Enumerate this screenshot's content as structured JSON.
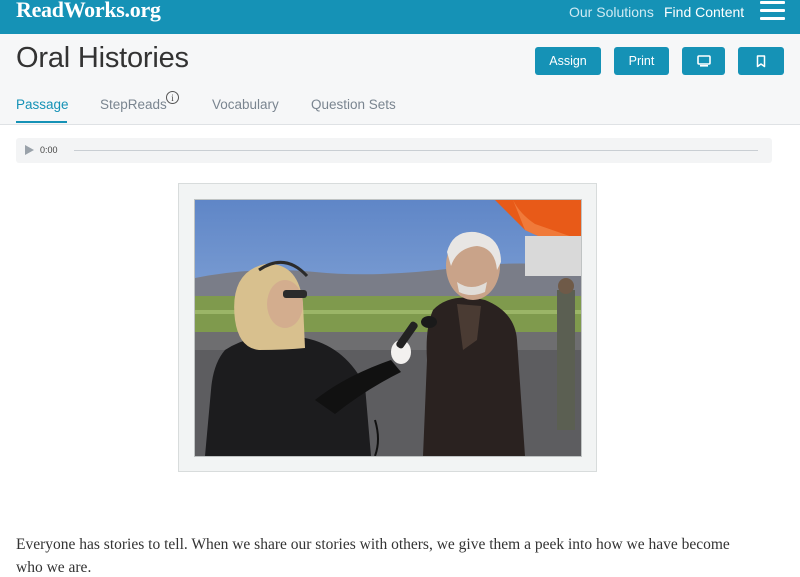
{
  "brand": {
    "name": "ReadWorks",
    "tld": ".org"
  },
  "nav": {
    "solutions": "Our Solutions",
    "find_content": "Find Content"
  },
  "page": {
    "title": "Oral Histories"
  },
  "actions": {
    "assign": "Assign",
    "print": "Print"
  },
  "tabs": [
    {
      "label": "Passage",
      "active": true
    },
    {
      "label": "StepReads"
    },
    {
      "label": "Vocabulary"
    },
    {
      "label": "Question Sets"
    }
  ],
  "info_icon_glyph": "i",
  "audio": {
    "time": "0:00"
  },
  "passage": {
    "text": "Everyone has stories to tell. When we share our stories with others, we give them a peek into how we have become who we are."
  },
  "colors": {
    "accent": "#1592b6",
    "header_bg": "#f6f7f8"
  },
  "icons": [
    "menu-icon",
    "info-icon",
    "play-icon",
    "monitor-icon",
    "bookmark-icon"
  ]
}
